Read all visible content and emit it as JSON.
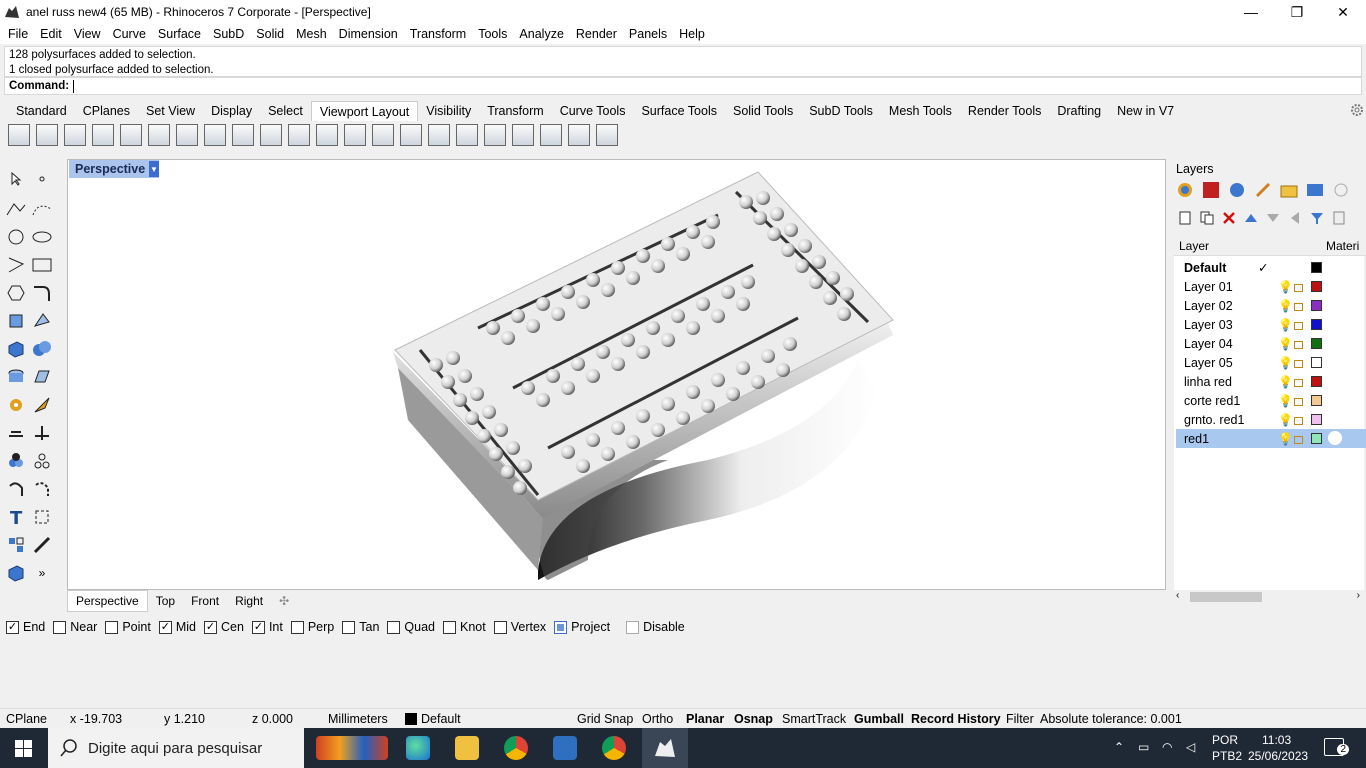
{
  "window": {
    "title": "anel russ new4 (65 MB) - Rhinoceros 7 Corporate - [Perspective]",
    "minimize": "—",
    "restore": "❐",
    "close": "✕"
  },
  "menu": [
    "File",
    "Edit",
    "View",
    "Curve",
    "Surface",
    "SubD",
    "Solid",
    "Mesh",
    "Dimension",
    "Transform",
    "Tools",
    "Analyze",
    "Render",
    "Panels",
    "Help"
  ],
  "command_history": [
    "128 polysurfaces added to selection.",
    "1 closed polysurface added to selection."
  ],
  "command_label": "Command:",
  "toolbar_tabs": [
    "Standard",
    "CPlanes",
    "Set View",
    "Display",
    "Select",
    "Viewport Layout",
    "Visibility",
    "Transform",
    "Curve Tools",
    "Surface Tools",
    "Solid Tools",
    "SubD Tools",
    "Mesh Tools",
    "Render Tools",
    "Drafting",
    "New in V7"
  ],
  "active_toolbar_tab": "Viewport Layout",
  "viewport": {
    "title": "Perspective",
    "dropdown": "▼"
  },
  "viewport_tabs": [
    "Perspective",
    "Top",
    "Front",
    "Right"
  ],
  "viewport_tab_add": "✣",
  "osnaps": [
    {
      "label": "End",
      "checked": true
    },
    {
      "label": "Near",
      "checked": false
    },
    {
      "label": "Point",
      "checked": false
    },
    {
      "label": "Mid",
      "checked": true
    },
    {
      "label": "Cen",
      "checked": true
    },
    {
      "label": "Int",
      "checked": true
    },
    {
      "label": "Perp",
      "checked": false
    },
    {
      "label": "Tan",
      "checked": false
    },
    {
      "label": "Quad",
      "checked": false
    },
    {
      "label": "Knot",
      "checked": false
    },
    {
      "label": "Vertex",
      "checked": false
    },
    {
      "label": "Project",
      "checked": true
    },
    {
      "label": "Disable",
      "checked": false
    }
  ],
  "layers_panel": {
    "title": "Layers",
    "col_layer": "Layer",
    "col_material": "Materi",
    "rows": [
      {
        "name": "Default",
        "color": "#000000",
        "current": true
      },
      {
        "name": "Layer 01",
        "color": "#c01010"
      },
      {
        "name": "Layer 02",
        "color": "#8a2ec4"
      },
      {
        "name": "Layer 03",
        "color": "#1010d0"
      },
      {
        "name": "Layer 04",
        "color": "#107010"
      },
      {
        "name": "Layer 05",
        "color": "#ffffff"
      },
      {
        "name": "linha red",
        "color": "#c01010"
      },
      {
        "name": "corte red1",
        "color": "#f0c890"
      },
      {
        "name": "grnto. red1",
        "color": "#f0c0f0"
      },
      {
        "name": "red1",
        "color": "#90e8b8",
        "selected": true
      }
    ],
    "current_mark": "✓"
  },
  "status": {
    "cplane": "CPlane",
    "x": "x -19.703",
    "y": "y 1.210",
    "z": "z 0.000",
    "units": "Millimeters",
    "layer": "Default",
    "grid_snap": "Grid Snap",
    "ortho": "Ortho",
    "planar": "Planar",
    "osnap": "Osnap",
    "smarttrack": "SmartTrack",
    "gumball": "Gumball",
    "record_history": "Record History",
    "filter": "Filter",
    "tolerance": "Absolute tolerance: 0.001"
  },
  "taskbar": {
    "search_placeholder": "Digite aqui para pesquisar",
    "lang1": "POR",
    "lang2": "PTB2",
    "time": "11:03",
    "date": "25/06/2023",
    "notif": "2"
  }
}
